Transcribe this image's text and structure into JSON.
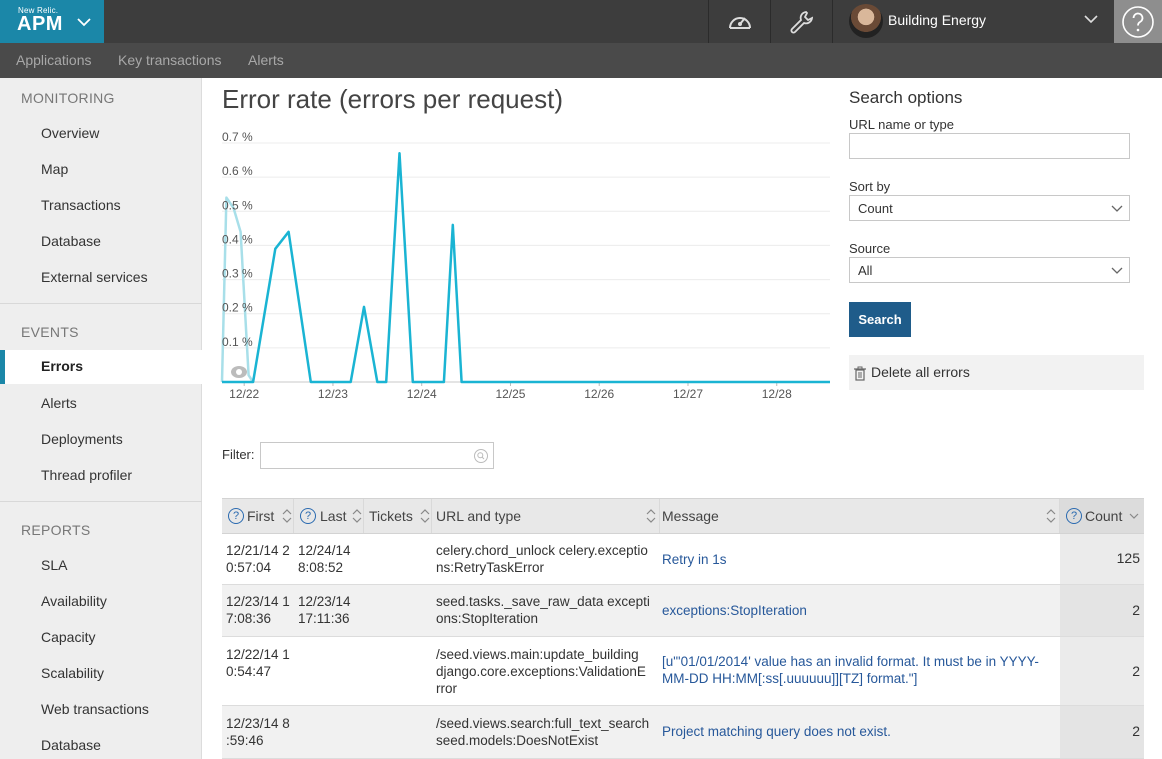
{
  "brand": {
    "small": "New Relic.",
    "product": "APM"
  },
  "account": {
    "name": "Building Energy"
  },
  "subnav": [
    "Applications",
    "Key transactions",
    "Alerts"
  ],
  "sidebar": {
    "monitoring_label": "MONITORING",
    "monitoring": [
      "Overview",
      "Map",
      "Transactions",
      "Database",
      "External services"
    ],
    "events_label": "EVENTS",
    "events": [
      "Errors",
      "Alerts",
      "Deployments",
      "Thread profiler"
    ],
    "reports_label": "REPORTS",
    "reports": [
      "SLA",
      "Availability",
      "Capacity",
      "Scalability",
      "Web transactions",
      "Database"
    ]
  },
  "page_title": "Error rate (errors per request)",
  "chart_data": {
    "type": "line",
    "title": "",
    "ylabel": "",
    "xlabel": "",
    "y_ticks": [
      "0.1 %",
      "0.2 %",
      "0.3 %",
      "0.4 %",
      "0.5 %",
      "0.6 %",
      "0.7 %"
    ],
    "x_ticks": [
      "12/22",
      "12/23",
      "12/24",
      "12/25",
      "12/26",
      "12/27",
      "12/28"
    ],
    "ylim": [
      0,
      0.7
    ],
    "xlim": [
      21.75,
      28.6
    ],
    "series": [
      {
        "color": "#1ab4d3",
        "x": [
          21.75,
          22.1,
          22.35,
          22.5,
          22.75,
          23.2,
          23.35,
          23.5,
          23.6,
          23.75,
          23.9,
          24.25,
          24.35,
          24.45,
          28.6
        ],
        "y": [
          0,
          0,
          0.39,
          0.44,
          0,
          0,
          0.22,
          0,
          0,
          0.67,
          0,
          0,
          0.46,
          0,
          0
        ]
      },
      {
        "color": "#a8dfe9",
        "x": [
          21.75,
          21.8,
          21.88,
          21.96,
          22.05,
          22.1
        ],
        "y": [
          0,
          0.54,
          0.51,
          0.44,
          0.02,
          0
        ]
      }
    ]
  },
  "search": {
    "title": "Search options",
    "url_label": "URL name or type",
    "url_value": "",
    "sort_label": "Sort by",
    "sort_value": "Count",
    "source_label": "Source",
    "source_value": "All",
    "button": "Search",
    "delete": "Delete all errors"
  },
  "filter": {
    "label": "Filter:",
    "value": ""
  },
  "table": {
    "columns": [
      "First",
      "Last",
      "Tickets",
      "URL and type",
      "Message",
      "Count"
    ],
    "rows": [
      {
        "first": [
          "12/21/14 2",
          "0:57:04"
        ],
        "last": [
          "12/24/14",
          "8:08:52"
        ],
        "url": [
          "celery.chord_unlock celery.exceptio",
          "ns:RetryTaskError"
        ],
        "message": [
          "Retry in 1s"
        ],
        "count": "125"
      },
      {
        "first": [
          "12/23/14 1",
          "7:08:36"
        ],
        "last": [
          "12/23/14",
          "17:11:36"
        ],
        "url": [
          "seed.tasks._save_raw_data excepti",
          "ons:StopIteration"
        ],
        "message": [
          "exceptions:StopIteration"
        ],
        "count": "2"
      },
      {
        "first": [
          "12/22/14 1",
          "0:54:47"
        ],
        "last": [],
        "url": [
          "/seed.views.main:update_building",
          "django.core.exceptions:ValidationE",
          "rror"
        ],
        "message": [
          "[u\"'01/01/2014' value has an invalid format. It must be in YYYY-",
          "MM-DD HH:MM[:ss[.uuuuuu]][TZ] format.\"]"
        ],
        "count": "2"
      },
      {
        "first": [
          "12/23/14 8",
          ":59:46"
        ],
        "last": [],
        "url": [
          "/seed.views.search:full_text_search",
          "seed.models:DoesNotExist"
        ],
        "message": [
          "Project matching query does not exist."
        ],
        "count": "2"
      }
    ]
  }
}
